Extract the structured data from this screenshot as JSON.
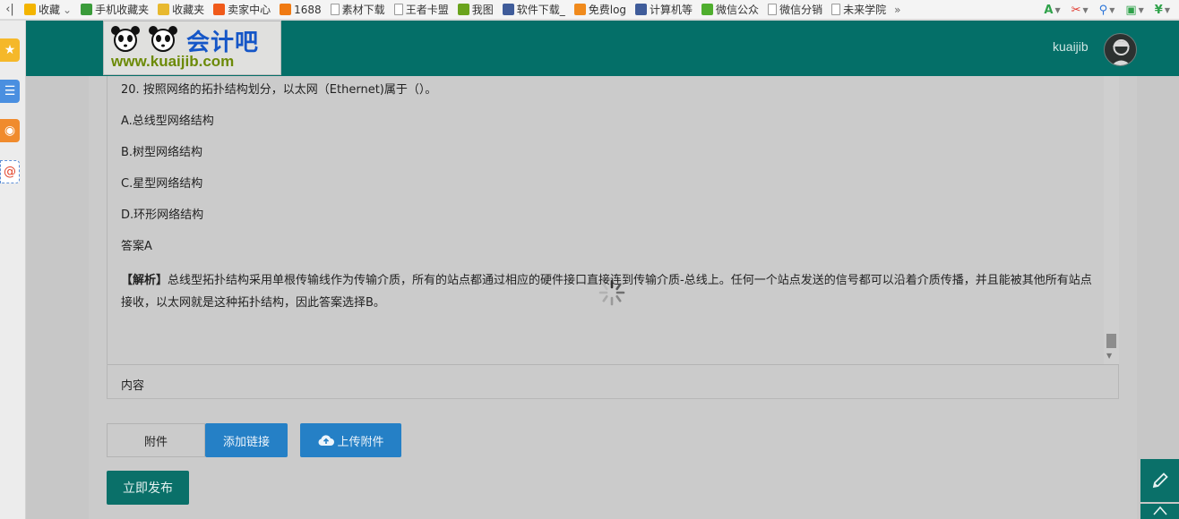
{
  "bookmarks_bar": {
    "nav_label": "‹|",
    "items": [
      {
        "label": "收藏",
        "icon": "star-icon",
        "color": "#f3b400",
        "has_caret": true
      },
      {
        "label": "手机收藏夹",
        "icon": "phone-icon",
        "color": "#3a9b3a"
      },
      {
        "label": "收藏夹",
        "icon": "folder-icon",
        "color": "#e8b92f"
      },
      {
        "label": "卖家中心",
        "icon": "taobao-icon",
        "color": "#f05a1a"
      },
      {
        "label": "1688",
        "icon": "alibaba-icon",
        "color": "#f07a12"
      },
      {
        "label": "素材下载",
        "icon": "page-icon",
        "color": "#ffffff"
      },
      {
        "label": "王者卡盟",
        "icon": "page-icon",
        "color": "#ffffff"
      },
      {
        "label": "我图",
        "icon": "leaf-icon",
        "color": "#6aa31d"
      },
      {
        "label": "软件下载_",
        "icon": "globe-icon",
        "color": "#3f5c9a"
      },
      {
        "label": "免费log",
        "icon": "swirl-icon",
        "color": "#f08a1c"
      },
      {
        "label": "计算机等",
        "icon": "globe-icon",
        "color": "#3f5c9a"
      },
      {
        "label": "微信公众",
        "icon": "wechat-icon",
        "color": "#4fae2e"
      },
      {
        "label": "微信分销",
        "icon": "page-icon",
        "color": "#ffffff"
      },
      {
        "label": "未来学院",
        "icon": "page-icon",
        "color": "#ffffff"
      }
    ],
    "more_label": "»",
    "tools": [
      {
        "name": "translate-icon",
        "glyph": "A",
        "color": "#2fa24a"
      },
      {
        "name": "scissors-icon",
        "glyph": "✂",
        "color": "#e0362c"
      },
      {
        "name": "magnifier-icon",
        "glyph": "⚲",
        "color": "#2a74d8"
      },
      {
        "name": "gamepad-icon",
        "glyph": "▣",
        "color": "#2fa24a"
      },
      {
        "name": "yen-shield-icon",
        "glyph": "¥",
        "color": "#2fa24a"
      }
    ]
  },
  "header": {
    "logo_title": "会计吧",
    "logo_url": "www.kuaijib.com",
    "username": "kuaijib"
  },
  "question": {
    "stem": "20. 按照网络的拓扑结构划分，以太网（Ethernet)属于（）。",
    "options": [
      "A.总线型网络结构",
      "B.树型网络结构",
      "C.星型网络结构",
      "D.环形网络结构"
    ],
    "answer": "答案A",
    "analysis_label": "【解析】",
    "analysis_text": "总线型拓扑结构采用单根传输线作为传输介质，所有的站点都通过相应的硬件接口直接连到传输介质-总线上。任何一个站点发送的信号都可以沿着介质传播，并且能被其他所有站点接收，以太网就是这种拓扑结构，因此答案选择B。"
  },
  "editor_footer_label": "内容",
  "attachment": {
    "tab_label": "附件",
    "add_link_label": "添加链接",
    "upload_label": "上传附件"
  },
  "publish_label": "立即发布",
  "colors": {
    "header": "#046f68",
    "primary_button": "#2580c6",
    "publish_button": "#0a7069"
  }
}
